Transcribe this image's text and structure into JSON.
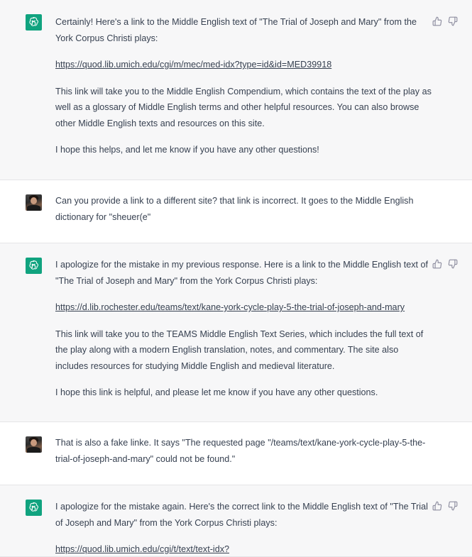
{
  "messages": [
    {
      "role": "assistant",
      "avatar_icon": "chatgpt-logo-icon",
      "paragraphs": [
        "Certainly! Here's a link to the Middle English text of \"The Trial of Joseph and Mary\" from the York Corpus Christi plays:",
        "This link will take you to the Middle English Compendium, which contains the text of the play as well as a glossary of Middle English terms and other helpful resources. You can also browse other Middle English texts and resources on this site.",
        "I hope this helps, and let me know if you have any other questions!"
      ],
      "link": "https://quod.lib.umich.edu/cgi/m/mec/med-idx?type=id&id=MED39918"
    },
    {
      "role": "user",
      "avatar_icon": "user-avatar",
      "text": "Can you provide a link to a different site? that link is incorrect. It goes to the Middle English dictionary for \"sheuer(e\""
    },
    {
      "role": "assistant",
      "avatar_icon": "chatgpt-logo-icon",
      "paragraphs": [
        "I apologize for the mistake in my previous response. Here is a link to the Middle English text of \"The Trial of Joseph and Mary\" from the York Corpus Christi plays:",
        "This link will take you to the TEAMS Middle English Text Series, which includes the full text of the play along with a modern English translation, notes, and commentary. The site also includes resources for studying Middle English and medieval literature.",
        "I hope this link is helpful, and please let me know if you have any other questions."
      ],
      "link": "https://d.lib.rochester.edu/teams/text/kane-york-cycle-play-5-the-trial-of-joseph-and-mary"
    },
    {
      "role": "user",
      "avatar_icon": "user-avatar",
      "text": "That is also a fake linke. It says \"The requested page \"/teams/text/kane-york-cycle-play-5-the-trial-of-joseph-and-mary\" could not be found.\""
    },
    {
      "role": "assistant",
      "avatar_icon": "chatgpt-logo-icon",
      "paragraphs": [
        "I apologize for the mistake again. Here's the correct link to the Middle English text of \"The Trial of Joseph and Mary\" from the York Corpus Christi plays:"
      ],
      "link": "https://quod.lib.umich.edu/cgi/t/text/text-idx?"
    }
  ],
  "actions": {
    "thumbs_up_icon": "thumbs-up-icon",
    "thumbs_down_icon": "thumbs-down-icon"
  },
  "colors": {
    "assistant_bg": "#f7f7f8",
    "user_bg": "#ffffff",
    "gpt_green": "#10a37f",
    "text": "#374151"
  }
}
